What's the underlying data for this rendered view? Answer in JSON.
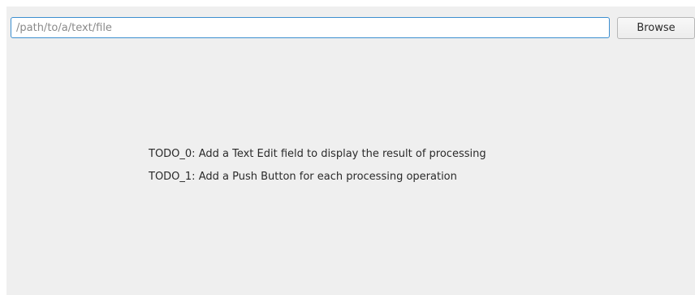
{
  "file_selector": {
    "path_placeholder": "/path/to/a/text/file",
    "path_value": "",
    "browse_label": "Browse"
  },
  "todos": [
    "TODO_0: Add a Text Edit field to display the result of processing",
    "TODO_1: Add a Push Button for each processing operation"
  ],
  "colors": {
    "window_bg": "#efefef",
    "input_focus_border": "#3d8fd0"
  }
}
